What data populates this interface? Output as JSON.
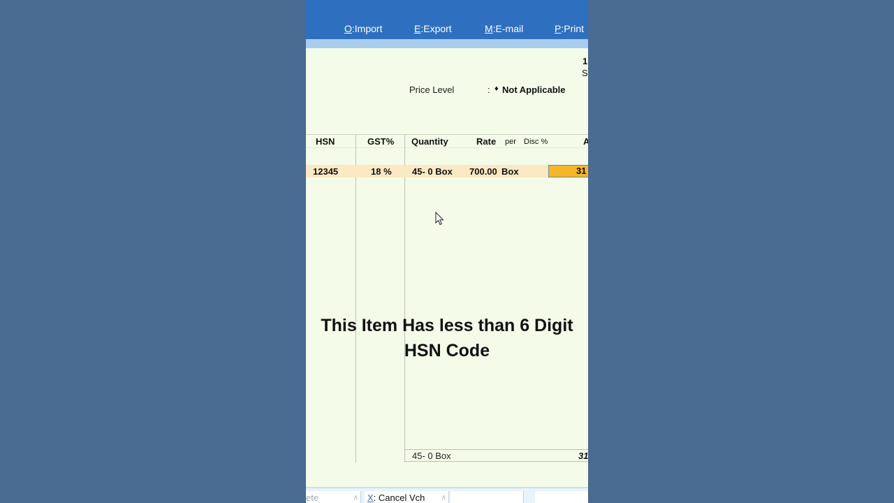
{
  "toolbar": {
    "import": {
      "key": "O",
      "label": ":Import"
    },
    "export": {
      "key": "E",
      "label": ":Export"
    },
    "email": {
      "key": "M",
      "label": ":E-mail"
    },
    "print": {
      "key": "P",
      "label": ":Print"
    }
  },
  "header_clip": {
    "line1": "1",
    "line2": "S"
  },
  "price_level": {
    "label": "Price Level",
    "separator": ":",
    "value": "Not Applicable"
  },
  "table": {
    "columns": {
      "hsn": "HSN",
      "gst": "GST%",
      "quantity": "Quantity",
      "rate": "Rate",
      "per": "per",
      "disc": "Disc %",
      "amount": "A"
    },
    "rows": [
      {
        "hsn": "12345",
        "gst": "18 %",
        "quantity": "45- 0 Box",
        "rate": "700.00",
        "per": "Box",
        "amount": "31"
      }
    ],
    "total": {
      "quantity": "45- 0 Box",
      "amount": "31"
    }
  },
  "overlay_caption": {
    "line1": "This Item Has less than 6 Digit",
    "line2": "HSN Code"
  },
  "footer": {
    "delete_partial": "ete",
    "cancel": {
      "key": "X",
      "label": ": Cancel Vch"
    }
  },
  "colors": {
    "toolbar": "#2f6fc0",
    "highlight_row": "#fbe9c4",
    "selected_cell": "#f5b629",
    "background": "#f4fbe9"
  }
}
